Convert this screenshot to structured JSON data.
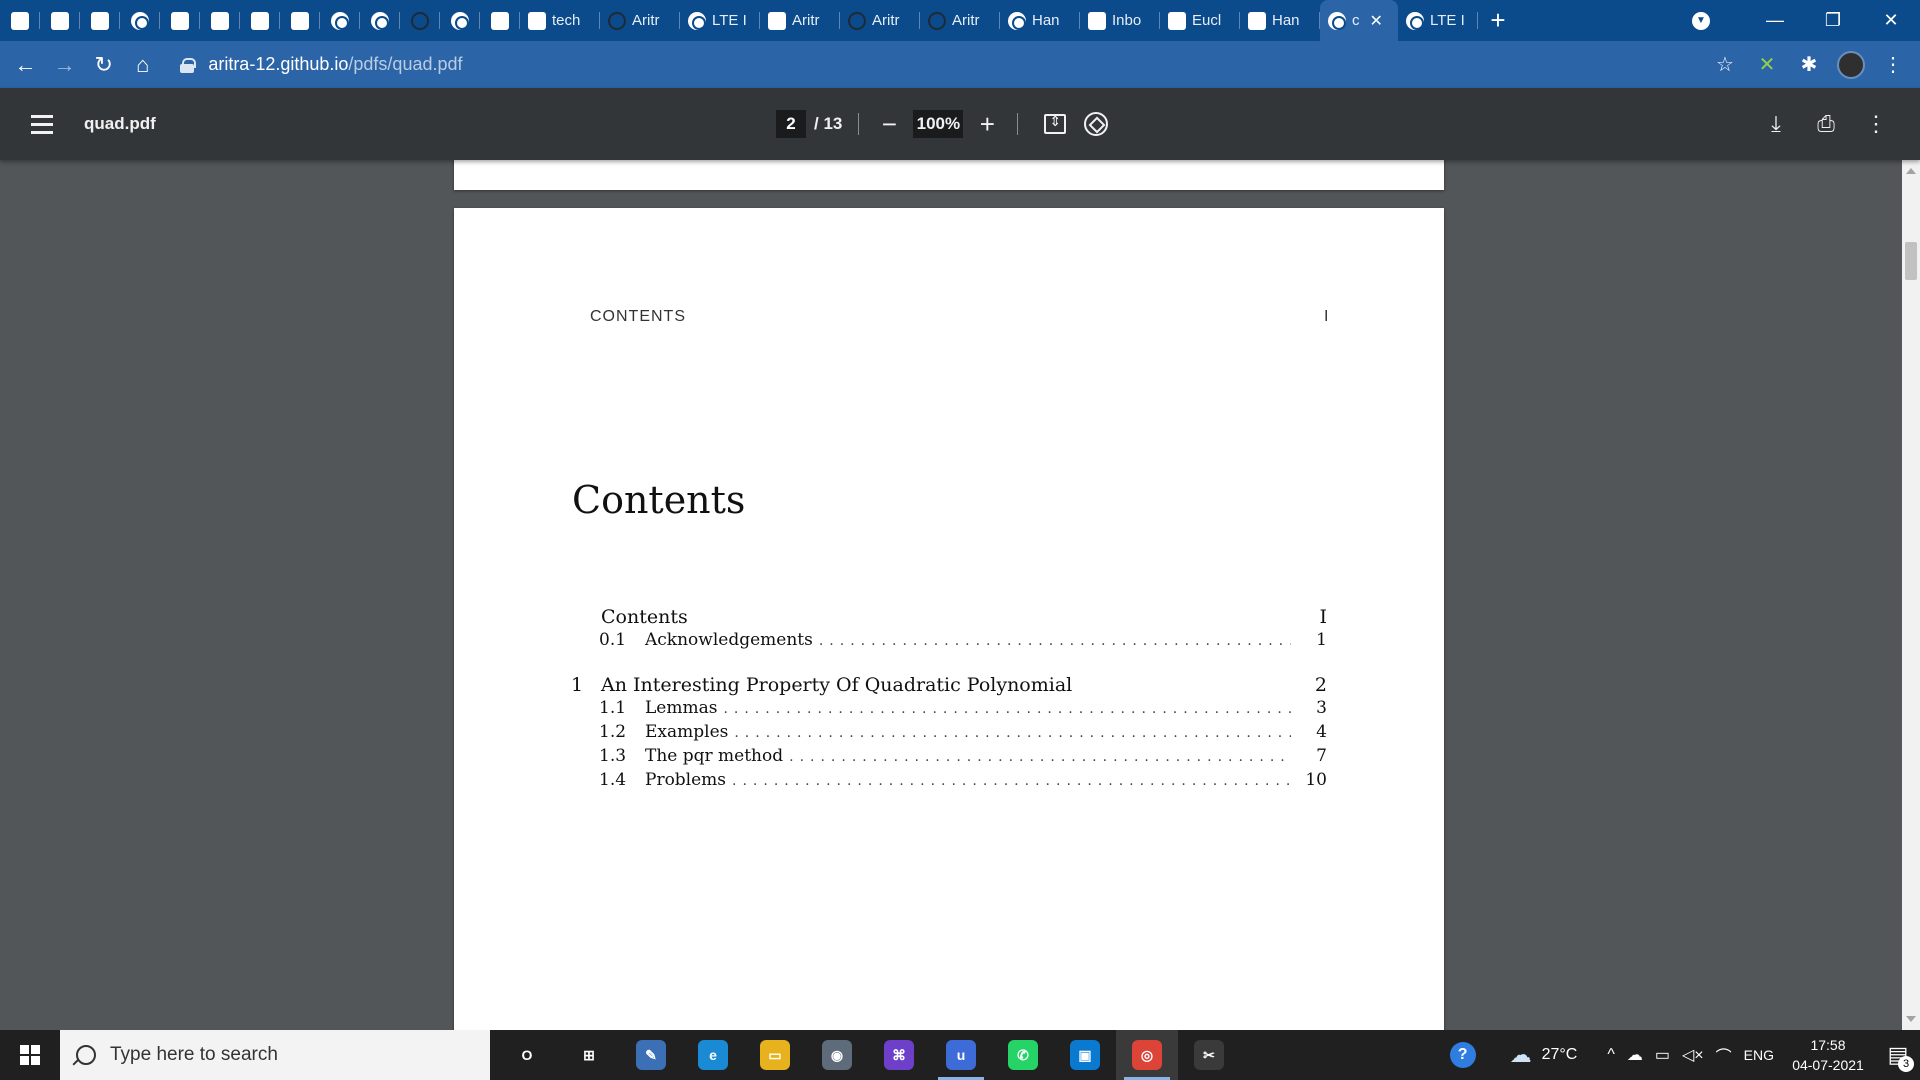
{
  "browser": {
    "tabs": [
      {
        "kind": "pinned",
        "icon": "pocket-icon",
        "title": ""
      },
      {
        "kind": "pinned",
        "icon": "s-logo-icon",
        "title": ""
      },
      {
        "kind": "pinned",
        "icon": "e-logo-icon",
        "title": ""
      },
      {
        "kind": "pinned",
        "icon": "globe-icon",
        "title": ""
      },
      {
        "kind": "pinned",
        "icon": "math-site-icon",
        "title": ""
      },
      {
        "kind": "pinned",
        "icon": "math-site-icon",
        "title": ""
      },
      {
        "kind": "pinned",
        "icon": "red-flag-icon",
        "title": ""
      },
      {
        "kind": "pinned",
        "icon": "wikipedia-icon",
        "title": ""
      },
      {
        "kind": "pinned",
        "icon": "globe-icon",
        "title": ""
      },
      {
        "kind": "pinned",
        "icon": "globe-icon",
        "title": ""
      },
      {
        "kind": "pinned",
        "icon": "github-icon",
        "title": ""
      },
      {
        "kind": "pinned",
        "icon": "globe-icon",
        "title": ""
      },
      {
        "kind": "pinned",
        "icon": "image-icon",
        "title": ""
      },
      {
        "kind": "normal",
        "icon": "tech-icon",
        "title": "tech"
      },
      {
        "kind": "normal",
        "icon": "github-icon",
        "title": "Aritr"
      },
      {
        "kind": "normal",
        "icon": "globe-icon",
        "title": "LTE I"
      },
      {
        "kind": "normal",
        "icon": "dark-square-icon",
        "title": "Aritr"
      },
      {
        "kind": "normal",
        "icon": "github-icon",
        "title": "Aritr"
      },
      {
        "kind": "normal",
        "icon": "github-icon",
        "title": "Aritr"
      },
      {
        "kind": "normal",
        "icon": "globe-icon",
        "title": "Han"
      },
      {
        "kind": "normal",
        "icon": "gmail-icon",
        "title": "Inbo"
      },
      {
        "kind": "normal",
        "icon": "image-icon",
        "title": "Eucl"
      },
      {
        "kind": "normal",
        "icon": "box-icon",
        "title": "Han"
      },
      {
        "kind": "active",
        "icon": "globe-icon",
        "title": "c"
      },
      {
        "kind": "normal",
        "icon": "globe-icon",
        "title": "LTE I"
      }
    ],
    "new_tab": "+",
    "url_host": "aritra-12.github.io",
    "url_path": "/pdfs/quad.pdf"
  },
  "pdf": {
    "filename": "quad.pdf",
    "current_page": "2",
    "total_pages": "/ 13",
    "zoom": "100%"
  },
  "document": {
    "running_head": "CONTENTS",
    "running_page": "I",
    "title": "Contents",
    "toc": [
      {
        "level": "section",
        "num": "",
        "label": "Contents",
        "page": "I"
      },
      {
        "level": "sub",
        "num": "0.1",
        "label": "Acknowledgements",
        "page": "1"
      },
      {
        "level": "section",
        "num": "1",
        "label": "An Interesting Property Of Quadratic Polynomial",
        "page": "2"
      },
      {
        "level": "sub",
        "num": "1.1",
        "label": "Lemmas",
        "page": "3"
      },
      {
        "level": "sub",
        "num": "1.2",
        "label": "Examples",
        "page": "4"
      },
      {
        "level": "sub",
        "num": "1.3",
        "label": "The pqr method",
        "page": "7"
      },
      {
        "level": "sub",
        "num": "1.4",
        "label": "Problems",
        "page": "10"
      }
    ]
  },
  "taskbar": {
    "search_placeholder": "Type here to search",
    "weather": "27°C",
    "language": "ENG",
    "time": "17:58",
    "date": "04-07-2021",
    "notification_count": "3",
    "apps": [
      {
        "name": "cortana-icon",
        "glyph": "O",
        "color": "#202020",
        "running": false
      },
      {
        "name": "task-view-icon",
        "glyph": "⊞",
        "color": "#202020",
        "running": false
      },
      {
        "name": "pen-icon",
        "glyph": "✎",
        "color": "#3b6fb6",
        "running": false
      },
      {
        "name": "edge-icon",
        "glyph": "e",
        "color": "#1a8ad4",
        "running": false
      },
      {
        "name": "file-explorer-icon",
        "glyph": "▭",
        "color": "#e8b21f",
        "running": false
      },
      {
        "name": "camera-icon",
        "glyph": "◉",
        "color": "#5d6b7a",
        "running": false
      },
      {
        "name": "github-desktop-icon",
        "glyph": "⌘",
        "color": "#6e40c9",
        "running": false
      },
      {
        "name": "notes-app-icon",
        "glyph": "u",
        "color": "#3d6bd8",
        "running": true
      },
      {
        "name": "whatsapp-icon",
        "glyph": "✆",
        "color": "#25d366",
        "running": false
      },
      {
        "name": "store-icon",
        "glyph": "▣",
        "color": "#0a7ad1",
        "running": false
      },
      {
        "name": "chrome-icon",
        "glyph": "◎",
        "color": "#db4437",
        "running": true
      },
      {
        "name": "snipping-tool-icon",
        "glyph": "✂",
        "color": "#3a3a3a",
        "running": false
      }
    ]
  }
}
